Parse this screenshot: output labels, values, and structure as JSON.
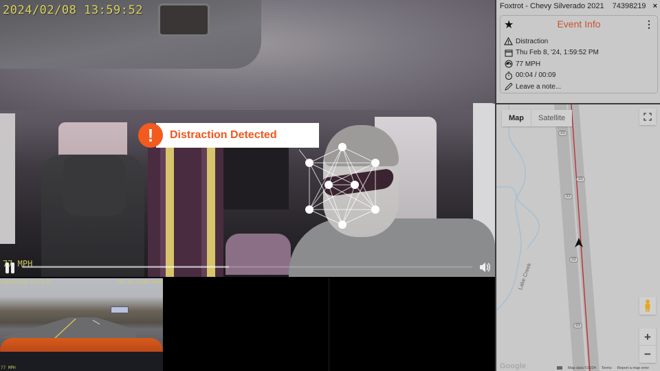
{
  "main_video": {
    "timestamp": "2024/02/08 13:59:52",
    "speed_overlay": "77 MPH",
    "alert_label": "Distraction Detected",
    "alert_icon": "exclamation",
    "playback_progress": 0.46,
    "controls": {
      "pause_icon": "pause-icon",
      "volume_icon": "volume-icon"
    }
  },
  "thumbnails": {
    "front_camera": {
      "timestamp": "2024/02/08 13:59:52",
      "info": "CH1 Q3 24FPS H0500",
      "speed": "77 MPH"
    }
  },
  "panel": {
    "header_title": "Foxtrot - Chevy Silverado 2021",
    "header_id": "74398219",
    "close_label": "×",
    "event_card": {
      "title": "Event Info",
      "star_icon": "★",
      "menu_icon": "⋮",
      "rows": [
        {
          "icon": "warning-icon",
          "text": "Distraction"
        },
        {
          "icon": "calendar-icon",
          "text": "Thu Feb 8, '24, 1:59:52 PM"
        },
        {
          "icon": "speedometer-icon",
          "text": "77 MPH"
        },
        {
          "icon": "stopwatch-icon",
          "text": "00:04 / 00:09"
        },
        {
          "icon": "pencil-icon",
          "text": "Leave a note..."
        }
      ]
    },
    "map": {
      "tabs": [
        "Map",
        "Satellite"
      ],
      "active_tab": "Map",
      "creek_label": "Lake Creek",
      "route_shield": "33",
      "logo": "Google",
      "footer": [
        "Map data ©2024",
        "Terms",
        "Report a map error"
      ],
      "zoom_in": "+",
      "zoom_out": "−",
      "colors": {
        "route": "#c0282d",
        "road": "#b3b3b3",
        "water": "#9dbfd6"
      }
    }
  }
}
